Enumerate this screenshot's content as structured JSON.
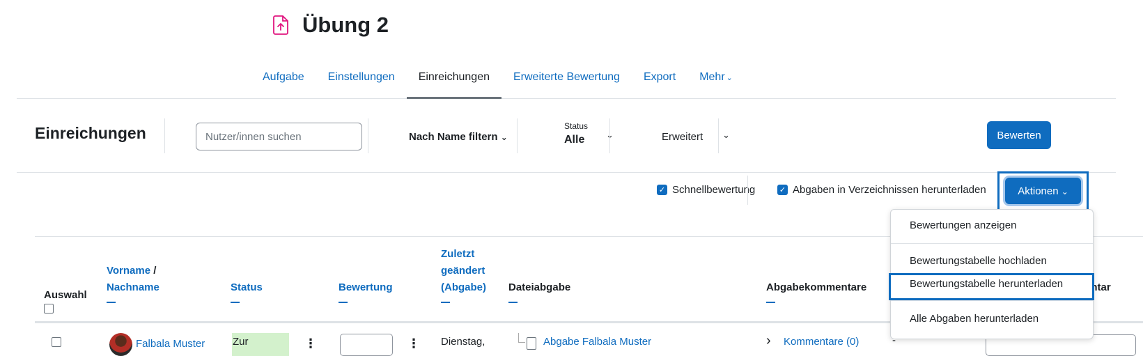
{
  "header": {
    "title": "Übung 2",
    "icon": "assignment-upload-icon",
    "icon_color": "#e0157f"
  },
  "secondary_nav": {
    "items": [
      {
        "label": "Aufgabe"
      },
      {
        "label": "Einstellungen"
      },
      {
        "label": "Einreichungen",
        "active": true
      },
      {
        "label": "Erweiterte Bewertung"
      },
      {
        "label": "Export"
      },
      {
        "label": "Mehr"
      }
    ]
  },
  "toolbar": {
    "title": "Einreichungen",
    "search_placeholder": "Nutzer/innen suchen",
    "name_filter": "Nach Name filtern",
    "status_label": "Status",
    "status_value": "Alle",
    "advanced": "Erweitert",
    "grade_button": "Bewerten"
  },
  "options": {
    "quick_grading": "Schnellbewertung",
    "quick_grading_checked": true,
    "download_folders": "Abgaben in Verzeichnissen herunterladen",
    "download_folders_checked": true,
    "actions_button": "Aktionen"
  },
  "actions_menu": {
    "items": [
      "Bewertungen anzeigen",
      "Bewertungstabelle hochladen",
      "Bewertungstabelle herunterladen",
      "Alle Abgaben herunterladen"
    ],
    "highlighted_index": 2
  },
  "table": {
    "headers": {
      "select": "Auswahl",
      "firstname": "Vorname",
      "slash": "/",
      "lastname": "Nachname",
      "status": "Status",
      "grade": "Bewertung",
      "modified_1": "Zuletzt",
      "modified_2": "geändert",
      "modified_3": "(Abgabe)",
      "file": "Dateiabgabe",
      "comments": "Abgabekommentare",
      "feedback_partial": "entar"
    },
    "rows": [
      {
        "name": "Falbala Muster",
        "status": "Zur",
        "modified": "Dienstag,",
        "file_link": "Abgabe Falbala Muster",
        "comments": "Kommentare (0)",
        "extra": "-"
      }
    ]
  },
  "colors": {
    "accent": "#0f6cbf",
    "status_bg": "#d3f1cc"
  }
}
